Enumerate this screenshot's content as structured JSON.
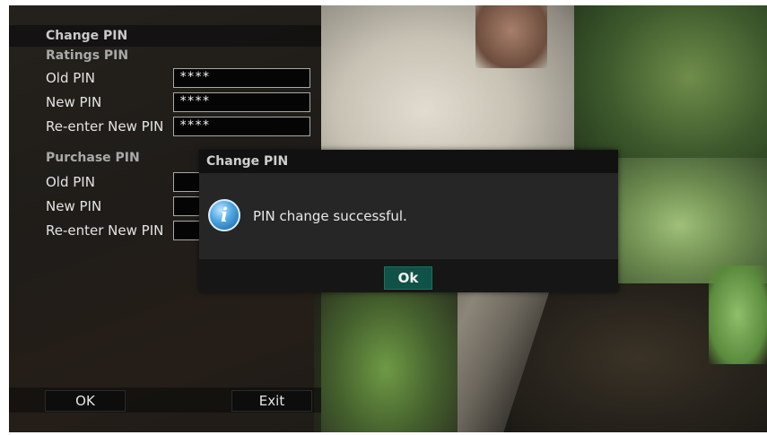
{
  "settings_panel": {
    "title": "Change PIN",
    "ratings_section": {
      "label": "Ratings PIN",
      "rows": [
        {
          "label": "Old PIN",
          "value": "****"
        },
        {
          "label": "New PIN",
          "value": "****"
        },
        {
          "label": "Re-enter New PIN",
          "value": "****"
        }
      ]
    },
    "purchase_section": {
      "label": "Purchase PIN",
      "rows": [
        {
          "label": "Old PIN",
          "value": ""
        },
        {
          "label": "New PIN",
          "value": ""
        },
        {
          "label": "Re-enter New PIN",
          "value": ""
        }
      ]
    },
    "footer": {
      "ok_label": "OK",
      "exit_label": "Exit"
    }
  },
  "dialog": {
    "title": "Change PIN",
    "icon": "info-icon",
    "icon_glyph": "i",
    "message": "PIN change successful.",
    "ok_label": "Ok",
    "ok_color": "#0f5247"
  }
}
